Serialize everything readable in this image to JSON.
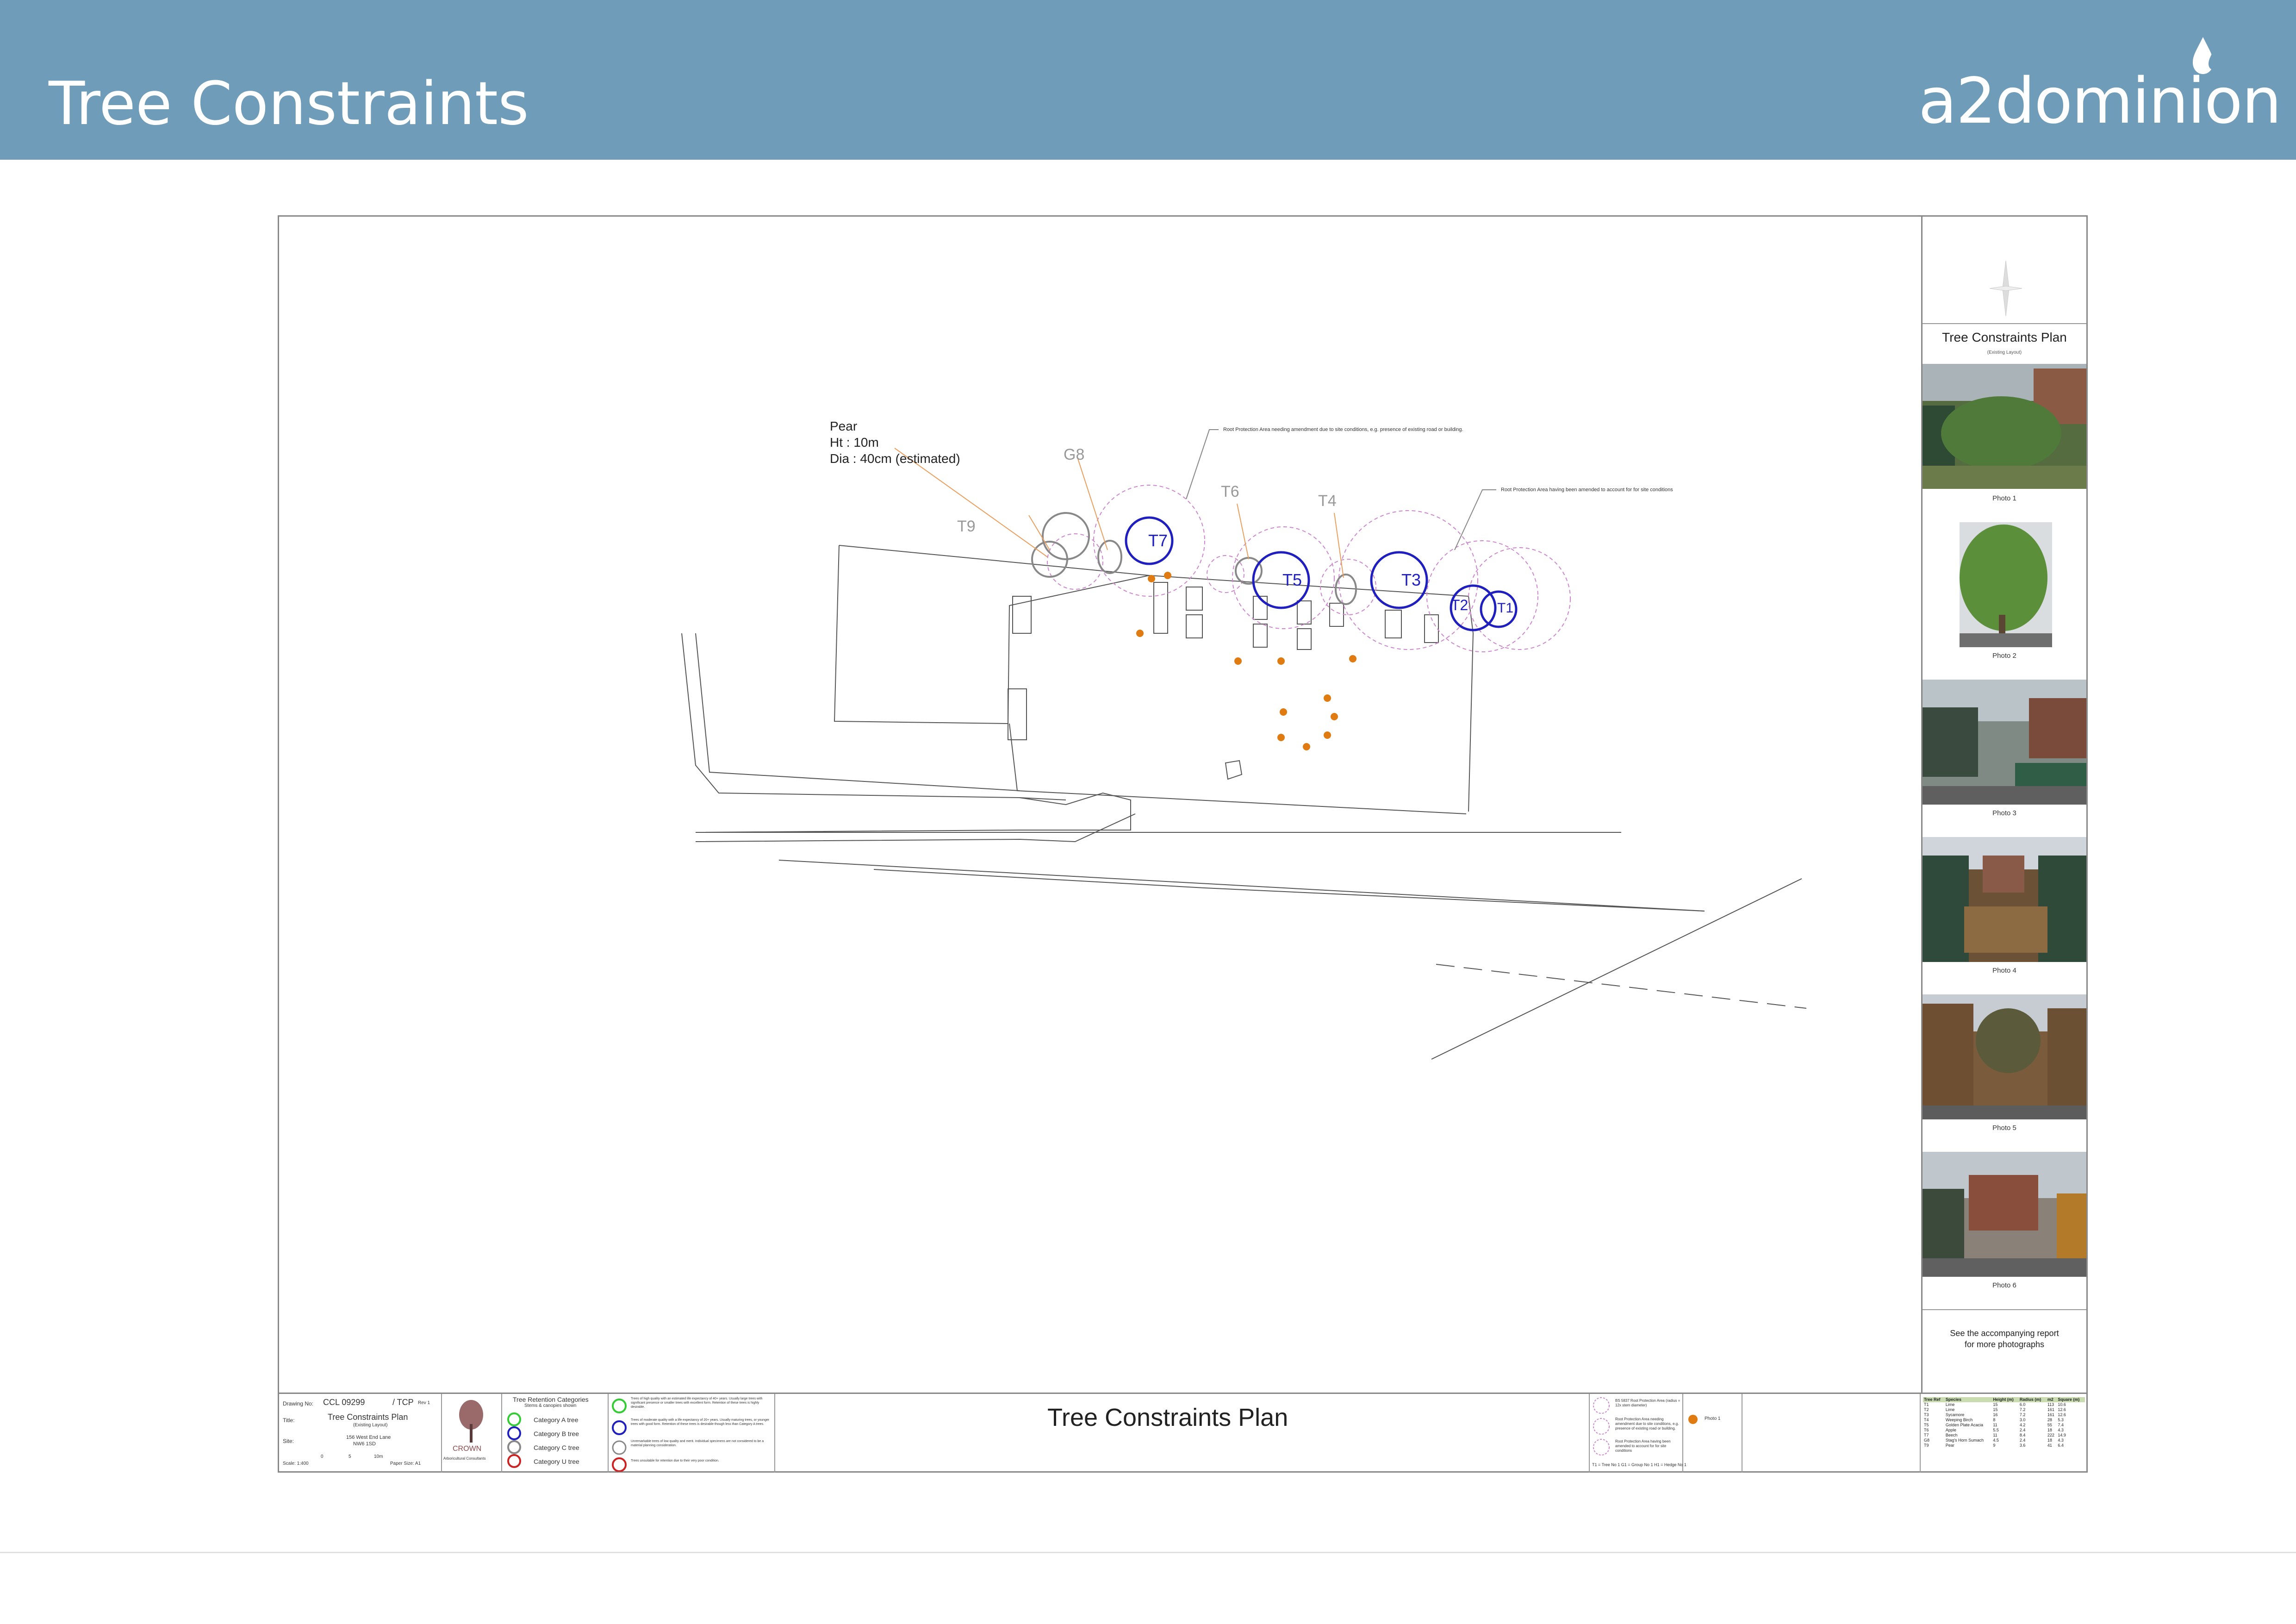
{
  "header": {
    "title": "Tree Constraints",
    "logo": "a2dominion"
  },
  "annotation": {
    "species": "Pear",
    "height": "Ht : 10m",
    "diameter": "Dia : 40cm (estimated)"
  },
  "trees": [
    {
      "label": "G8"
    },
    {
      "label": "T9"
    },
    {
      "label": "T6"
    },
    {
      "label": "T4"
    },
    {
      "label": "T7"
    },
    {
      "label": "T5"
    },
    {
      "label": "T3"
    },
    {
      "label": "T2"
    },
    {
      "label": "T1"
    }
  ],
  "notes": {
    "rpa_amendment": "Root Protection Area needing amendment due to site conditions, e.g. presence of existing road or building.",
    "rpa_amended": "Root Protection Area having been amended to account for for site conditions"
  },
  "side": {
    "title": "Tree Constraints Plan",
    "subtitle": "(Existing Layout)",
    "photos": [
      "Photo 1",
      "Photo 2",
      "Photo 3",
      "Photo 4",
      "Photo 5",
      "Photo 6"
    ],
    "note_line1": "See the accompanying report",
    "note_line2": "for more photographs"
  },
  "titleblock": {
    "drawing_no_label": "Drawing No:",
    "drawing_no": "CCL 09299",
    "drawing_suffix": "/ TCP",
    "rev": "Rev 1",
    "title_label": "Title:",
    "title": "Tree Constraints Plan",
    "title_sub": "(Existing Layout)",
    "site_label": "Site:",
    "site": "156 West End Lane",
    "site_sub": "NW6 1SD",
    "scale_label": "Scale: 1:400",
    "scale_0": "0",
    "scale_5": "5",
    "scale_10": "10m",
    "paper_size": "Paper Size: A1",
    "company": "CROWN",
    "company_sub": "Arboricultural Consultants",
    "categories_title": "Tree Retention Categories",
    "categories_sub": "Stems & canopies shown",
    "categories": [
      "Category A tree",
      "Category B tree",
      "Category C tree",
      "Category U tree"
    ],
    "category_notes": [
      "Trees of high quality with an estimated life expectancy of 40+ years. Usually large trees with significant presence or smaller trees with excellent form. Retention of these trees is highly desirable.",
      "Trees of moderate quality with a life expectancy of 20+ years. Usually maturing trees, or younger trees with good form. Retention of these trees is desirable though less than Category A trees.",
      "Unremarkable trees of low quality and merit. Individual specimens are not considered to be a material planning consideration.",
      "Trees unsuitable for retention due to their very poor condition."
    ],
    "main_title": "Tree Constraints Plan",
    "legend_rpa": "BS 5837 Root Protection Area (radius = 12x stem diameter)",
    "legend_amend": "Root Protection Area needing amendment due to site conditions, e.g. presence of existing road or building.",
    "legend_amended": "Root Protection Area having been amended to account for for site conditions",
    "legend_keys": "T1 = Tree No 1    G1 = Group No 1    H1 = Hedge No 1",
    "photo_key": "Photo 1"
  },
  "schedule": {
    "headers": [
      "Tree Ref",
      "Species",
      "Height (m)",
      "Radius (m)",
      "m2",
      "Square (m)"
    ],
    "rows": [
      [
        "T1",
        "Lime",
        "15",
        "6.0",
        "113",
        "10.6"
      ],
      [
        "T2",
        "Lime",
        "15",
        "7.2",
        "161",
        "12.6"
      ],
      [
        "T3",
        "Sycamore",
        "16",
        "7.2",
        "161",
        "12.6"
      ],
      [
        "T4",
        "Weeping Birch",
        "8",
        "3.0",
        "28",
        "5.3"
      ],
      [
        "T5",
        "Golden Plate Acacia",
        "11",
        "4.2",
        "55",
        "7.4"
      ],
      [
        "T6",
        "Apple",
        "5.5",
        "2.4",
        "18",
        "4.3"
      ],
      [
        "T7",
        "Beech",
        "11",
        "8.4",
        "222",
        "14.9"
      ],
      [
        "G8",
        "Stag's Horn Sumach",
        "4.5",
        "2.4",
        "18",
        "4.3"
      ],
      [
        "T9",
        "Pear",
        "9",
        "3.6",
        "41",
        "6.4"
      ]
    ]
  },
  "colors": {
    "header_bg": "#6f9cb9",
    "cat_a": "#33cc33",
    "cat_b": "#1f1fbf",
    "cat_c": "#888888",
    "cat_u": "#cc2222",
    "rpa": "#cc88cc",
    "marker": "#e07b12"
  }
}
